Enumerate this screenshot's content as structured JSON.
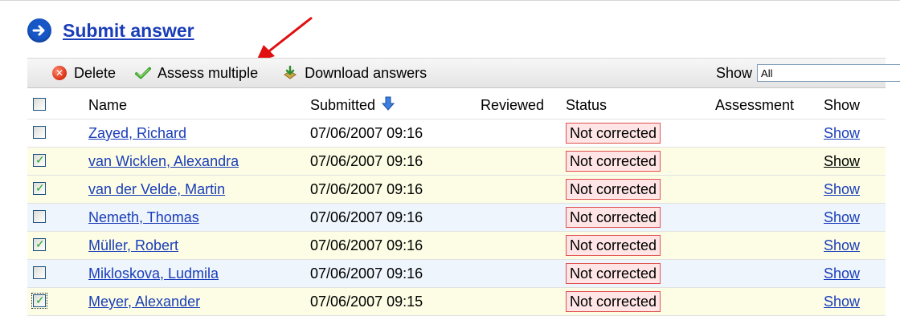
{
  "header": {
    "title": "Submit answer"
  },
  "toolbar": {
    "delete_label": "Delete",
    "assess_label": "Assess multiple",
    "download_label": "Download answers",
    "show_label": "Show",
    "show_select_value": "All"
  },
  "table": {
    "columns": {
      "name": "Name",
      "submitted": "Submitted",
      "reviewed": "Reviewed",
      "status": "Status",
      "assessment": "Assessment",
      "show": "Show"
    },
    "rows": [
      {
        "name": "Zayed, Richard",
        "submitted": "07/06/2007 09:16",
        "reviewed": "",
        "status": "Not corrected",
        "assessment": "",
        "show": "Show",
        "checked": false
      },
      {
        "name": "van Wicklen, Alexandra",
        "submitted": "07/06/2007 09:16",
        "reviewed": "",
        "status": "Not corrected",
        "assessment": "",
        "show": "Show",
        "checked": true
      },
      {
        "name": "van der Velde, Martin",
        "submitted": "07/06/2007 09:16",
        "reviewed": "",
        "status": "Not corrected",
        "assessment": "",
        "show": "Show",
        "checked": true
      },
      {
        "name": "Nemeth, Thomas",
        "submitted": "07/06/2007 09:16",
        "reviewed": "",
        "status": "Not corrected",
        "assessment": "",
        "show": "Show",
        "checked": false
      },
      {
        "name": "Müller, Robert",
        "submitted": "07/06/2007 09:16",
        "reviewed": "",
        "status": "Not corrected",
        "assessment": "",
        "show": "Show",
        "checked": true
      },
      {
        "name": "Mikloskova, Ludmila",
        "submitted": "07/06/2007 09:16",
        "reviewed": "",
        "status": "Not corrected",
        "assessment": "",
        "show": "Show",
        "checked": false
      },
      {
        "name": "Meyer, Alexander",
        "submitted": "07/06/2007 09:15",
        "reviewed": "",
        "status": "Not corrected",
        "assessment": "",
        "show": "Show",
        "checked": true
      }
    ]
  },
  "colors": {
    "link": "#1a3db8",
    "status_border": "#e05050",
    "row_yellow": "#fcfde4",
    "row_blue": "#eef5fc",
    "annotation_arrow": "#e01010"
  },
  "icons": {
    "header": "arrow-right-circle-icon",
    "delete": "delete-icon",
    "assess": "checkmark-icon",
    "download": "download-icon",
    "sort": "sort-down-arrow-icon",
    "select": "chevron-down-icon"
  }
}
